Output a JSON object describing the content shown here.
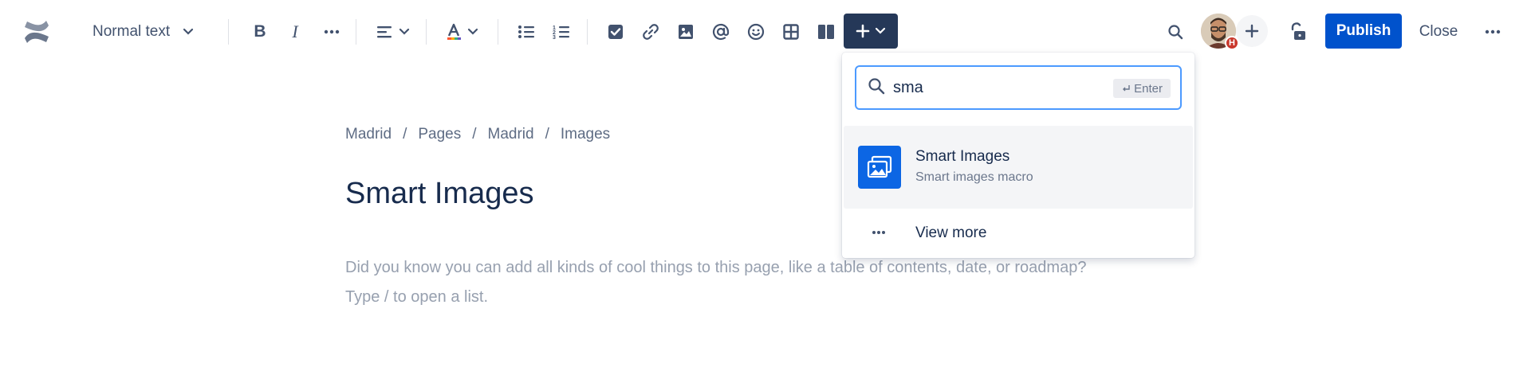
{
  "toolbar": {
    "text_style": "Normal text",
    "bold_glyph": "B",
    "italic_glyph": "I",
    "publish_label": "Publish",
    "close_label": "Close",
    "avatar_badge": "H"
  },
  "breadcrumb": {
    "items": [
      "Madrid",
      "Pages",
      "Madrid",
      "Images"
    ],
    "separator": "/"
  },
  "page": {
    "title": "Smart Images",
    "placeholder_line1": "Did you know you can add all kinds of cool things to this page, like a table of contents, date, or roadmap?",
    "placeholder_line2": "Type / to open a list."
  },
  "insert_menu": {
    "search_value": "sma",
    "enter_hint": "Enter",
    "results": [
      {
        "title": "Smart Images",
        "description": "Smart images macro",
        "icon": "image-stack-icon"
      }
    ],
    "view_more_label": "View more"
  },
  "colors": {
    "accent": "#0052cc",
    "insert_button": "#253858",
    "text_color_swatch": "#ff5630",
    "result_icon_bg": "#0c66e4"
  }
}
